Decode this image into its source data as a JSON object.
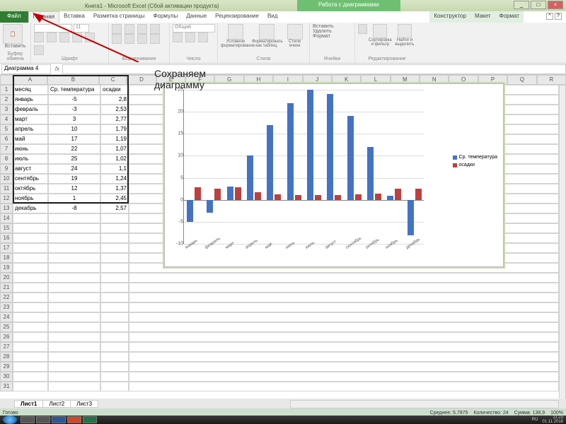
{
  "title": {
    "app": "Книга1 - Microsoft Excel (Сбой активации продукта)",
    "context": "Работа с диаграммами"
  },
  "winbtns": {
    "min": "_",
    "max": "□",
    "close": "×"
  },
  "tabs": {
    "file": "Файл",
    "items": [
      "Главная",
      "Вставка",
      "Разметка страницы",
      "Формулы",
      "Данные",
      "Рецензирование",
      "Вид"
    ],
    "ctx": [
      "Конструктор",
      "Макет",
      "Формат"
    ],
    "active_index": 0
  },
  "ribbon": {
    "paste": "Вставить",
    "clipboard": "Буфер обмена",
    "font": "Шрифт",
    "font_name": "",
    "font_size": "11",
    "align": "Выравнивание",
    "number": "Число",
    "number_fmt": "Общий",
    "styles": "Стили",
    "cond": "Условное форматирование",
    "table": "Форматировать как таблиц.",
    "cellst": "Стили ячеек",
    "cells": "Ячейки",
    "insert": "Вставить",
    "delete": "Удалить",
    "format": "Формат",
    "editing": "Редактирование",
    "sort": "Сортировка и фильтр",
    "find": "Найти и выделить"
  },
  "namebox": "Диаграмма 4",
  "annotation_l1": "Сохраняем",
  "annotation_l2": "диаграмму",
  "headers": {
    "a": "месяц",
    "b": "Ср. температура",
    "c": "осадки"
  },
  "cols": [
    "A",
    "B",
    "C",
    "D",
    "E",
    "F",
    "G",
    "H",
    "I",
    "J",
    "K",
    "L",
    "M",
    "N",
    "O",
    "P",
    "Q",
    "R"
  ],
  "rows": [
    {
      "a": "январь",
      "b": "-5",
      "c": "2,8"
    },
    {
      "a": "февраль",
      "b": "-3",
      "c": "2,53"
    },
    {
      "a": "март",
      "b": "3",
      "c": "2,77"
    },
    {
      "a": "апрель",
      "b": "10",
      "c": "1,79"
    },
    {
      "a": "май",
      "b": "17",
      "c": "1,19"
    },
    {
      "a": "июнь",
      "b": "22",
      "c": "1,07"
    },
    {
      "a": "июль",
      "b": "25",
      "c": "1,02"
    },
    {
      "a": "август",
      "b": "24",
      "c": "1,1"
    },
    {
      "a": "сентябрь",
      "b": "19",
      "c": "1,24"
    },
    {
      "a": "октябрь",
      "b": "12",
      "c": "1,37"
    },
    {
      "a": "ноябрь",
      "b": "1",
      "c": "2,45"
    },
    {
      "a": "декабрь",
      "b": "-8",
      "c": "2,57"
    }
  ],
  "sheets": [
    "Лист1",
    "Лист2",
    "Лист3"
  ],
  "status": {
    "ready": "Готово",
    "avg": "Среднее: 5,7875",
    "count": "Количество: 24",
    "sum": "Сумма: 138,9",
    "zoom": "100%"
  },
  "tray": {
    "lang": "RU",
    "time": "11:23",
    "date": "01.11.2018"
  },
  "legend": {
    "s1": "Ср. температура",
    "s2": "осадки"
  },
  "chart_data": {
    "type": "bar",
    "categories": [
      "январь",
      "февраль",
      "март",
      "апрель",
      "май",
      "июнь",
      "июль",
      "август",
      "сентябрь",
      "октябрь",
      "ноябрь",
      "декабрь"
    ],
    "series": [
      {
        "name": "Ср. температура",
        "values": [
          -5,
          -3,
          3,
          10,
          17,
          22,
          25,
          24,
          19,
          12,
          1,
          -8
        ],
        "color": "#4473c4"
      },
      {
        "name": "осадки",
        "values": [
          2.8,
          2.53,
          2.77,
          1.79,
          1.19,
          1.07,
          1.02,
          1.1,
          1.24,
          1.37,
          2.45,
          2.57
        ],
        "color": "#bf3f3f"
      }
    ],
    "ylim": [
      -10,
      25
    ],
    "yticks": [
      -10,
      -5,
      0,
      5,
      10,
      15,
      20,
      25
    ],
    "xlabel": "",
    "ylabel": "",
    "title": ""
  }
}
